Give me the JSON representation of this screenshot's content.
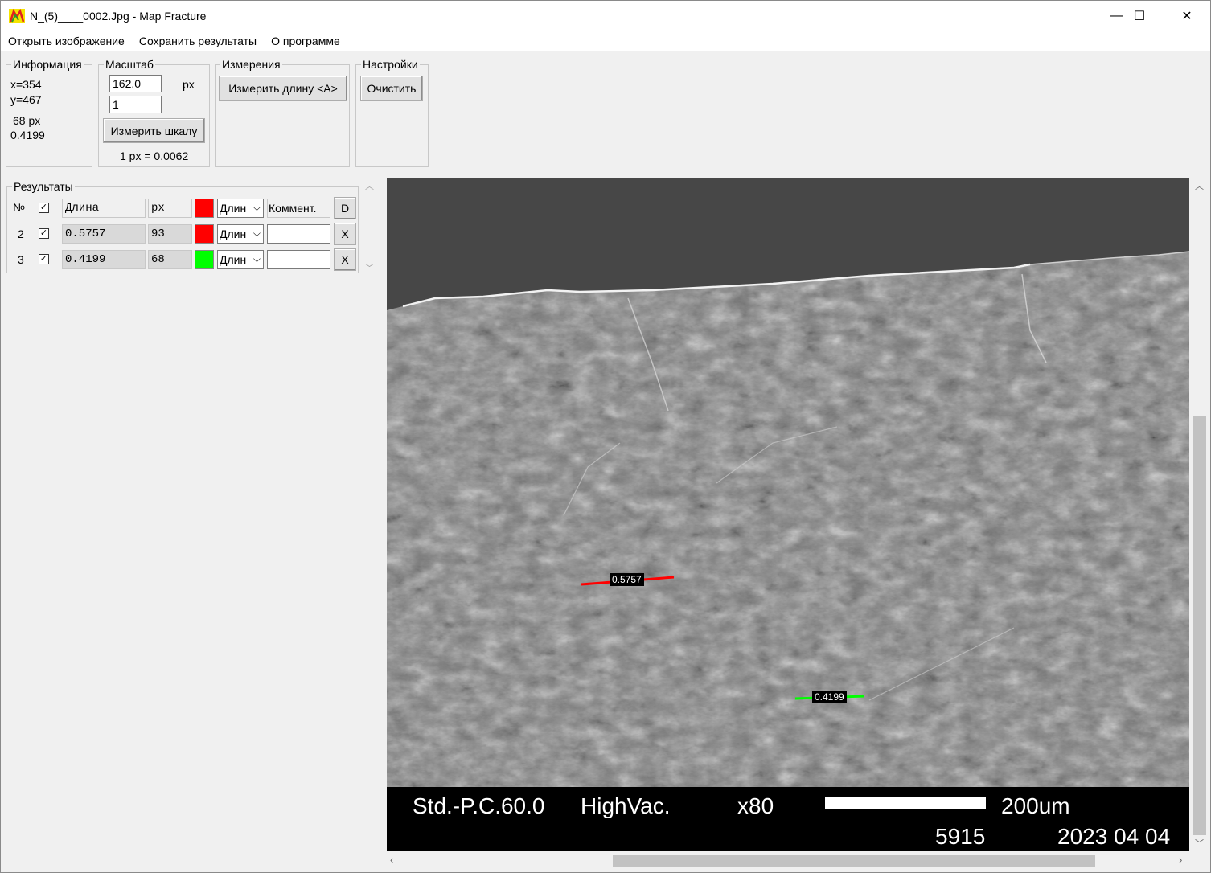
{
  "window": {
    "title": "N_(5)____0002.Jpg - Map Fracture",
    "minimize": "—",
    "maximize": "☐",
    "close": "✕"
  },
  "menu": [
    "Открыть изображение",
    "Сохранить результаты",
    "О программе"
  ],
  "info": {
    "legend": "Информация",
    "x": "x=354",
    "y": "y=467",
    "px": "68 px",
    "value": "0.4199"
  },
  "scale": {
    "legend": "Масштаб",
    "px_value": "162.0",
    "px_unit": "px",
    "real_value": "1",
    "measure_button": "Измерить шкалу",
    "ratio": "1 px = 0.0062"
  },
  "measurements": {
    "legend": "Измерения",
    "measure_button": "Измерить длину <A>"
  },
  "settings": {
    "legend": "Настройки",
    "clear_button": "Очистить"
  },
  "results": {
    "legend": "Результаты",
    "header": {
      "num": "№",
      "checked": true,
      "length": "Длина",
      "px": "px",
      "color": "#ff0000",
      "type": "Длин",
      "comment": "Коммент.",
      "action": "D"
    },
    "rows": [
      {
        "num": "2",
        "checked": true,
        "length": "0.5757",
        "px": "93",
        "color": "#ff0000",
        "type": "Длин",
        "comment": "",
        "action": "X"
      },
      {
        "num": "3",
        "checked": true,
        "length": "0.4199",
        "px": "68",
        "color": "#00ff00",
        "type": "Длин",
        "comment": "",
        "action": "X"
      }
    ]
  },
  "image": {
    "measure_labels": [
      "0.5757",
      "0.4199"
    ],
    "measure_colors": [
      "#ff0000",
      "#00ff00"
    ],
    "sem_info": {
      "mode": "Std.-P.C.60.0",
      "vacuum": "HighVac.",
      "magnification": "x80",
      "scale_label": "200um",
      "number": "5915",
      "date": "2023 04 04"
    }
  }
}
